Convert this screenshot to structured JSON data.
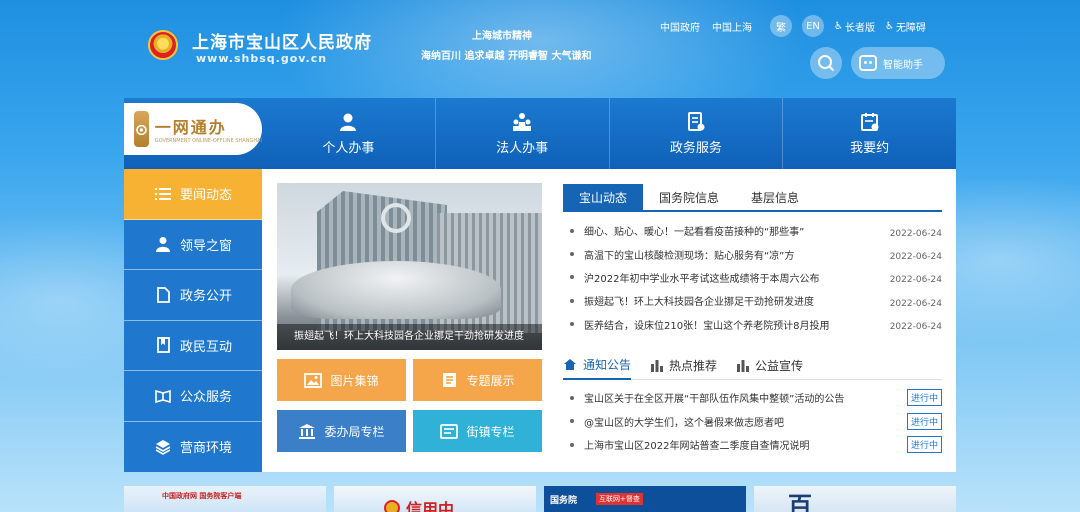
{
  "header": {
    "site_title": "上海市宝山区人民政府",
    "site_url": "www.shbsq.gov.cn",
    "spirit_title": "上海城市精神",
    "spirit_slogan": "海纳百川 追求卓越 开明睿智 大气谦和",
    "links": [
      "中国政府",
      "中国上海"
    ],
    "traditional_btn": "繁",
    "english_btn": "EN",
    "elder_link": "长者版",
    "accessible_link": "无障碍",
    "assistant_btn": "智能助手"
  },
  "service_bar": {
    "brand_main": "一网通办",
    "brand_sub": "GOVERNMENT ONLINE-OFFLINE SHANGHAI",
    "items": [
      {
        "label": "个人办事",
        "icon": "person-icon"
      },
      {
        "label": "法人办事",
        "icon": "enterprise-icon"
      },
      {
        "label": "政务服务",
        "icon": "document-icon"
      },
      {
        "label": "我要约",
        "icon": "calendar-icon"
      }
    ]
  },
  "left_nav": {
    "items": [
      {
        "label": "要闻动态",
        "icon": "list-icon",
        "active": true
      },
      {
        "label": "领导之窗",
        "icon": "user-icon",
        "active": false
      },
      {
        "label": "政务公开",
        "icon": "file-icon",
        "active": false
      },
      {
        "label": "政民互动",
        "icon": "bookmark-icon",
        "active": false
      },
      {
        "label": "公众服务",
        "icon": "book-icon",
        "active": false
      },
      {
        "label": "营商环境",
        "icon": "layers-icon",
        "active": false
      }
    ]
  },
  "photo": {
    "caption": "振翅起飞！环上大科技园各企业挪足干劲抢研发进度"
  },
  "quick_buttons": [
    {
      "label": "图片集锦",
      "icon": "image-icon"
    },
    {
      "label": "专题展示",
      "icon": "topic-icon"
    },
    {
      "label": "委办局专栏",
      "icon": "bank-icon"
    },
    {
      "label": "街镇专栏",
      "icon": "window-icon"
    }
  ],
  "news": {
    "tabs": [
      "宝山动态",
      "国务院信息",
      "基层信息"
    ],
    "items": [
      {
        "title": "细心、贴心、暖心！一起看看疫苗接种的“那些事”",
        "date": "2022-06-24"
      },
      {
        "title": "高温下的宝山核酸检测现场：贴心服务有“凉”方",
        "date": "2022-06-24"
      },
      {
        "title": "沪2022年初中学业水平考试这些成绩将于本周六公布",
        "date": "2022-06-24"
      },
      {
        "title": "振翅起飞！环上大科技园各企业挪足干劲抢研发进度",
        "date": "2022-06-24"
      },
      {
        "title": "医养结合，设床位210张！宝山这个养老院预计8月投用",
        "date": "2022-06-24"
      }
    ]
  },
  "notices": {
    "tabs": [
      {
        "label": "通知公告",
        "icon": "home-icon"
      },
      {
        "label": "热点推荐",
        "icon": "bars-icon"
      },
      {
        "label": "公益宣传",
        "icon": "bars-icon"
      }
    ],
    "items": [
      {
        "title": "宝山区关于在全区开展“干部队伍作风集中整顿”活动的公告",
        "badge": "进行中"
      },
      {
        "title": "@宝山区的大学生们，这个暑假来做志愿者吧",
        "badge": "进行中"
      },
      {
        "title": "上海市宝山区2022年网站普查二季度自查情况说明",
        "badge": "进行中"
      }
    ]
  },
  "banners": {
    "b1_text": "中国政府网 国务院客户端",
    "b2_text": "信用中",
    "b3_text": "国务院",
    "b3_tag": "互联网+督查",
    "b4_text": "百"
  },
  "colors": {
    "primary_blue": "#1665b5",
    "nav_blue": "#1f78cd",
    "active_orange": "#f7b233"
  }
}
